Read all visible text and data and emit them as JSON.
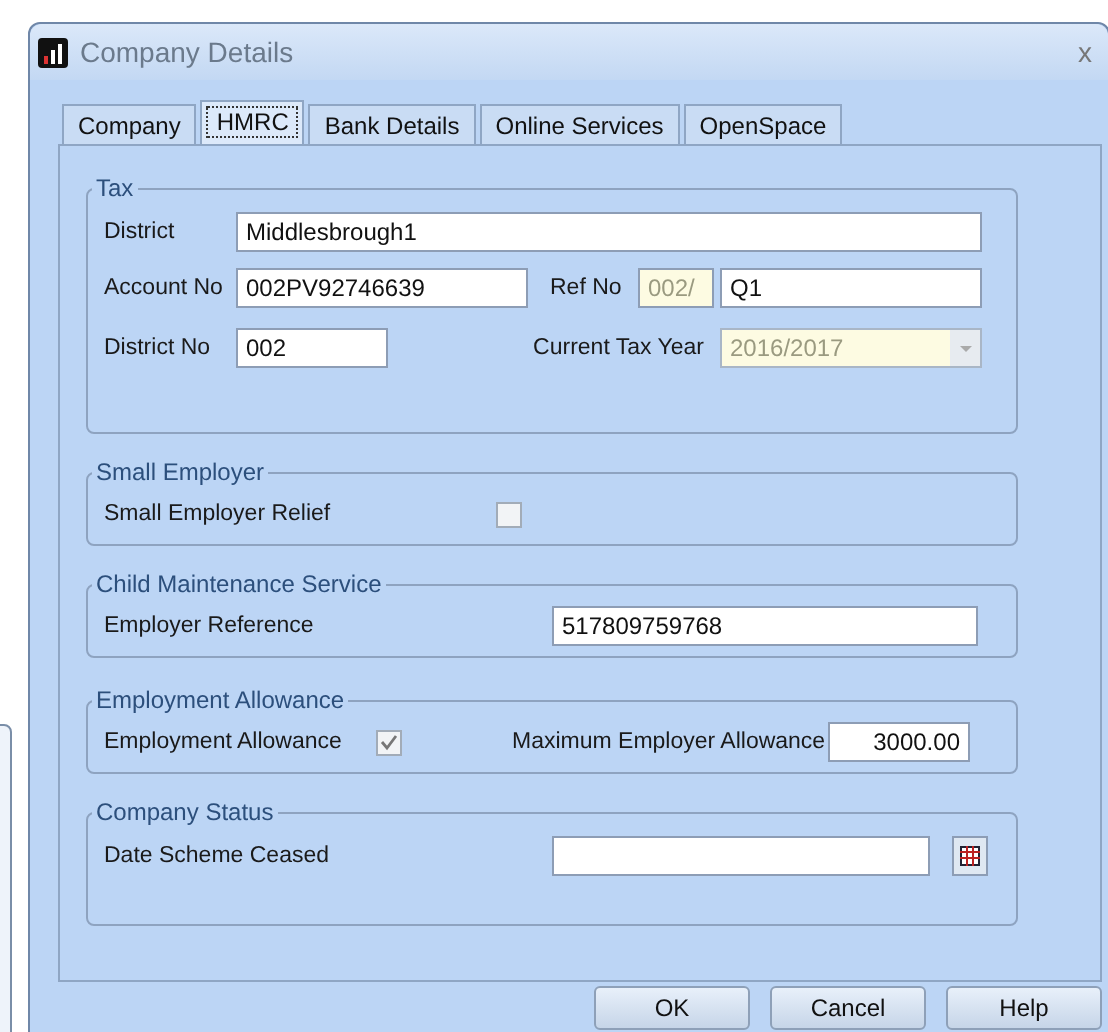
{
  "window": {
    "title": "Company Details",
    "close": "x"
  },
  "tabs": [
    {
      "label": "Company",
      "selected": false
    },
    {
      "label": "HMRC",
      "selected": true
    },
    {
      "label": "Bank Details",
      "selected": false
    },
    {
      "label": "Online Services",
      "selected": false
    },
    {
      "label": "OpenSpace",
      "selected": false
    }
  ],
  "tax": {
    "title": "Tax",
    "district": {
      "label": "District",
      "value": "Middlesbrough1"
    },
    "account_no": {
      "label": "Account No",
      "value": "002PV92746639"
    },
    "ref_no": {
      "label": "Ref No",
      "prefix": "002/",
      "prefix_disabled": true,
      "value": "Q1"
    },
    "district_no": {
      "label": "District No",
      "value": "002"
    },
    "current_tax_year": {
      "label": "Current Tax Year",
      "value": "2016/2017",
      "disabled": true
    }
  },
  "small_employer": {
    "title": "Small Employer",
    "label": "Small Employer Relief",
    "checked": false
  },
  "child_maintenance": {
    "title": "Child Maintenance Service",
    "label": "Employer Reference",
    "value": "517809759768"
  },
  "employment_allowance": {
    "title": "Employment Allowance",
    "label": "Employment Allowance",
    "checked": true,
    "max_label": "Maximum Employer Allowance",
    "max_value": "3000.00"
  },
  "company_status": {
    "title": "Company Status",
    "label": "Date Scheme Ceased"
  },
  "buttons": [
    "OK",
    "Cancel",
    "Help"
  ]
}
